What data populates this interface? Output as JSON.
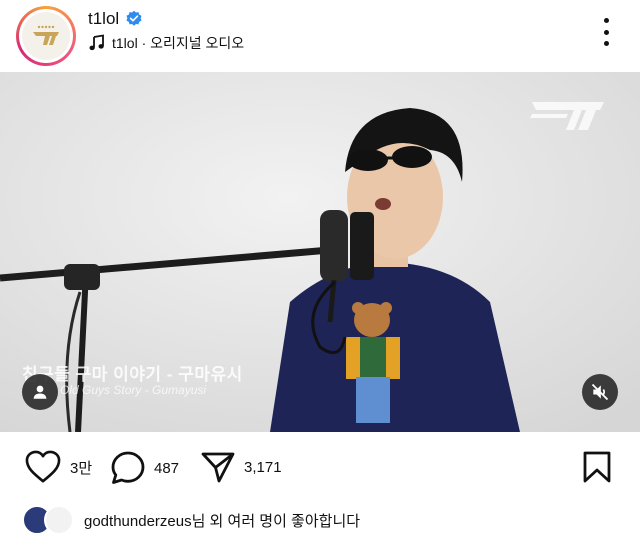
{
  "header": {
    "username": "t1lol",
    "audio_label": "t1lol · 오리지널 오디오"
  },
  "media": {
    "caption_korean": "친구들 구마 이야기 - 구마유시",
    "caption_english": "Old Guys Story - Gumayusi",
    "watermark": "T1"
  },
  "actions": {
    "like_count": "3만",
    "comment_count": "487",
    "share_count": "3,171"
  },
  "liked_by": {
    "text": "godthunderzeus님 외 여러 명이 좋아합니다"
  },
  "colors": {
    "verified_blue": "#2e8bf0",
    "ring_gradient_start": "#f9a23a",
    "ring_gradient_end": "#d62976"
  }
}
